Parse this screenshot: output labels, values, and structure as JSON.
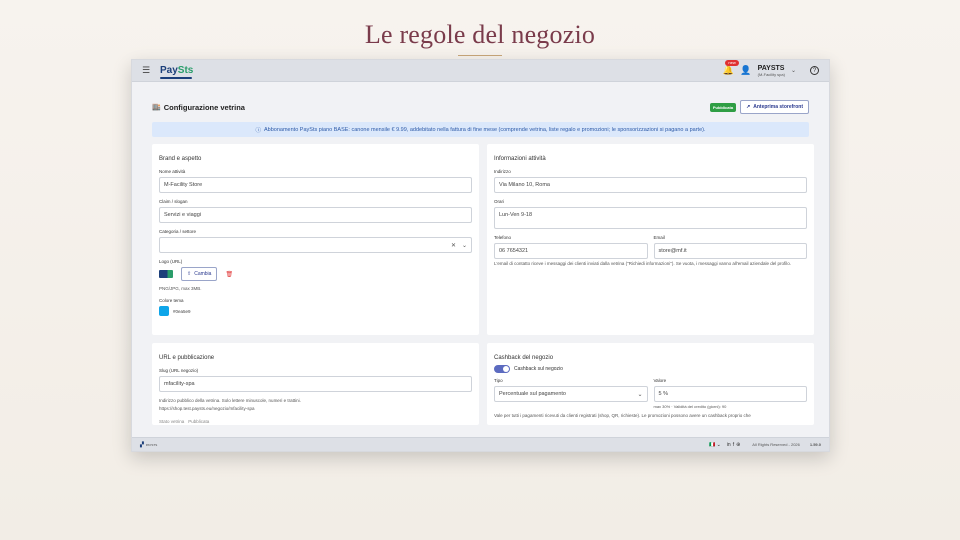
{
  "slide": {
    "title": "Le regole del negozio"
  },
  "topbar": {
    "brand_a": "Pay",
    "brand_b": "Sts",
    "notif_badge": "new",
    "user_name": "PAYSTS",
    "user_company": "(M-Facility spa)"
  },
  "header": {
    "title": "Configurazione vetrina",
    "status_badge": "Pubblicata",
    "preview_label": "Anteprima storefront"
  },
  "banner": {
    "text": "Abbonamento PaySts piano BASE: canone mensile € 9.99, addebitato nella fattura di fine mese (comprende vetrina, liste regalo e promozioni; le sponsorizzazioni si pagano a parte)."
  },
  "brand": {
    "title": "Brand e aspetto",
    "name_label": "Nome attività",
    "name_value": "M-Facility Store",
    "claim_label": "Claim / slogan",
    "claim_value": "Servizi e viaggi",
    "category_label": "Categoria / settore",
    "category_value": "",
    "logo_label": "Logo (URL)",
    "change_label": "Cambia",
    "logo_hint": "PNG/JPG, max 3MB.",
    "color_label": "Colore tema",
    "color_value": "#0ea5e9"
  },
  "info": {
    "title": "Informazioni attività",
    "address_label": "Indirizzo",
    "address_value": "Via Milano 10, Roma",
    "hours_label": "Orari",
    "hours_value": "Lun-Ven 9-18",
    "phone_label": "Telefono",
    "phone_value": "06 7654321",
    "email_label": "Email",
    "email_value": "store@mf.it",
    "hint": "L'email di contatto riceve i messaggi dei clienti inviati dalla vetrina (\"Richiedi informazioni\"). Se vuota, i messaggi vanno all'email aziendale del profilo."
  },
  "url": {
    "title": "URL e pubblicazione",
    "slug_label": "Slug (URL negozio)",
    "slug_value": "mfacility-spa",
    "hint1": "Indirizzo pubblico della vetrina. Solo lettere minuscole, numeri e trattini.",
    "hint2": "https://shop.test.paysts.eu/negozio/mfacility-spa",
    "state_label": "Stato vetrina",
    "state_value": "Pubblicata"
  },
  "cashback": {
    "title": "Cashback del negozio",
    "toggle_label": "Cashback sul negozio",
    "type_label": "Tipo",
    "type_value": "Percentuale sul pagamento",
    "value_label": "Valore",
    "value_value": "5 %",
    "value_hint": "max 30% · Validità del credito (giorni): 90",
    "hint": "Vale per tutti i pagamenti ricevuti da clienti registrati (shop, QR, richieste). Le promozioni possono avere un cashback proprio che"
  },
  "footer": {
    "logo_text": "PAYSTS",
    "rights": "All Rights Reserved - 2026",
    "version": "1.59.0"
  },
  "colors": {
    "accent": "#5c6bc0",
    "theme": "#0ea5e9",
    "success": "#2f9e44"
  }
}
